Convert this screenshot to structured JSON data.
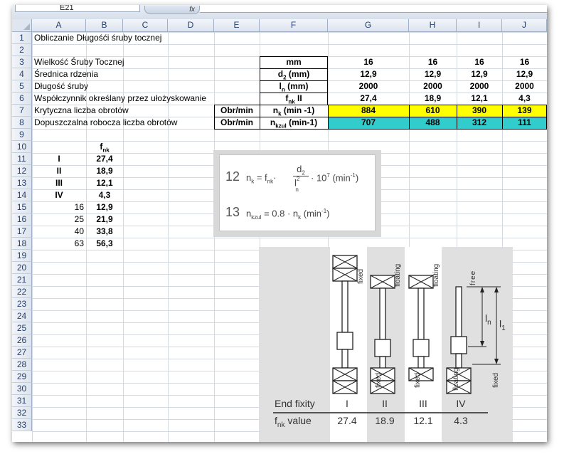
{
  "formula_bar": {
    "name_box": "E21",
    "fx": "fx"
  },
  "columns": [
    "A",
    "B",
    "C",
    "D",
    "E",
    "F",
    "G",
    "H",
    "I",
    "J"
  ],
  "rows": [
    "1",
    "2",
    "3",
    "4",
    "5",
    "6",
    "7",
    "8",
    "9",
    "10",
    "11",
    "12",
    "13",
    "14",
    "15",
    "16",
    "17",
    "18",
    "19",
    "20",
    "21",
    "22",
    "23",
    "24",
    "25",
    "26",
    "27",
    "28",
    "29",
    "30",
    "31",
    "32",
    "33"
  ],
  "sheet": {
    "title": "Obliczanie Długośći śruby tocznej",
    "labels": {
      "r3": "Wielkość Śruby Tocznej",
      "r4": "Średnica rdzenia",
      "r5": "Długość śruby",
      "r6": "Współczynnik określany przez ułożyskowanie",
      "r7": "Krytyczna liczba obrotów",
      "r8": "Dopuszczalna robocza liczba obrotów"
    },
    "units_e": {
      "r7": "Obr/min",
      "r8": "Obr/min"
    },
    "param_f": {
      "r3": "mm",
      "r4_base": "d",
      "r4_sub": "2",
      "r4_rest": " (mm)",
      "r5_base": "l",
      "r5_sub": "n",
      "r5_rest": " (mm)",
      "r6_base": "f",
      "r6_sub": "nk",
      "r6_rest": "  II",
      "r7_base": "n",
      "r7_sub": "k",
      "r7_rest": " (min -1)",
      "r8_base": "n",
      "r8_sub": "kzul",
      "r8_rest": " (min-1)"
    },
    "values": {
      "G": [
        "16",
        "12,9",
        "2000",
        "27,4",
        "884",
        "707"
      ],
      "H": [
        "16",
        "12,9",
        "2000",
        "18,9",
        "610",
        "488"
      ],
      "I": [
        "16",
        "12,9",
        "2000",
        "12,1",
        "390",
        "312"
      ],
      "J": [
        "16",
        "12,9",
        "2000",
        "4,3",
        "139",
        "111"
      ]
    },
    "fnk_header_base": "f",
    "fnk_header_sub": "nk",
    "fixity_table": [
      {
        "roman": "I",
        "value": "27,4"
      },
      {
        "roman": "II",
        "value": "18,9"
      },
      {
        "roman": "III",
        "value": "12,1"
      },
      {
        "roman": "IV",
        "value": "4,3"
      }
    ],
    "diameter_table": [
      {
        "d": "16",
        "value": "12,9"
      },
      {
        "d": "25",
        "value": "21,9"
      },
      {
        "d": "40",
        "value": "33,8"
      },
      {
        "d": "63",
        "value": "56,3"
      }
    ]
  },
  "formula_image": {
    "n12": "12",
    "n13": "13",
    "f12_lhs": "n",
    "f12_lhs_sub": "k",
    "f12_eq": " = f",
    "f12_f_sub": "nk",
    "f12_dot": "·",
    "f12_num": "d",
    "f12_num_sub": "2",
    "f12_den": "l",
    "f12_den_sup": "2",
    "f12_den_sub": "n",
    "f12_tail": "· 10",
    "f12_exp": "7",
    "f12_unit": " (min",
    "f12_unit_exp": "-1",
    "f12_close": ")",
    "f13_lhs": "n",
    "f13_lhs_sub": "kzul",
    "f13_rest": " = 0.8 · n",
    "f13_nk_sub": "k",
    "f13_unit": "  (min",
    "f13_unit_exp": "-1",
    "f13_close": ")"
  },
  "bearing_figure": {
    "labels_top": [
      "fixed",
      "floating",
      "floating",
      "free"
    ],
    "labels_bottom": [
      "fixed",
      "fixed",
      "floating",
      "fixed"
    ],
    "dim_ln": "l",
    "dim_ln_sub": "n",
    "dim_l1": "l",
    "dim_l1_sub": "1",
    "end_fixity_label": "End fixity",
    "fixity": [
      "I",
      "II",
      "III",
      "IV"
    ],
    "fnk_label_base": "f",
    "fnk_label_sub": "nk",
    "fnk_label_rest": " value",
    "fnk_values": [
      "27.4",
      "18.9",
      "12.1",
      "4.3"
    ]
  },
  "colors": {
    "yellow": "#ffff00",
    "teal": "#33cccc",
    "header": "#dde4ee"
  }
}
